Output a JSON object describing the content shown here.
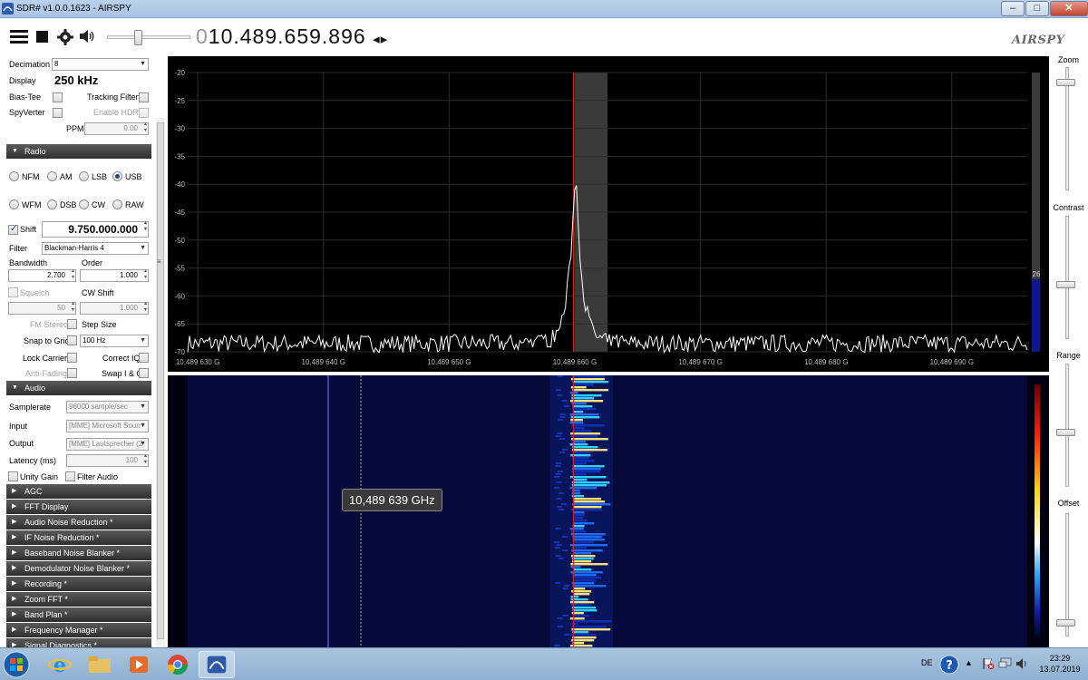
{
  "window": {
    "title": "SDR# v1.0.0.1623 - AIRSPY",
    "controls": {
      "minimize": "–",
      "maximize": "□",
      "close": "✕"
    }
  },
  "toolbar": {
    "frequency_lead": "0",
    "frequency": "10.489.659.896",
    "freq_arrows": "◂▸",
    "logo": "AIRSPY",
    "icons": [
      "menu-icon",
      "stop-icon",
      "gear-icon",
      "speaker-icon"
    ],
    "volume_level": 0.35
  },
  "source": {
    "decimation_label": "Decimation",
    "decimation_value": "8",
    "display_label": "Display",
    "display_value": "250 kHz",
    "bias_tee_label": "Bias-Tee",
    "tracking_filter_label": "Tracking Filter",
    "spyverter_label": "SpyVerter",
    "enable_hdr_label": "Enable HDR",
    "ppm_label": "PPM",
    "ppm_value": "0.00"
  },
  "radio": {
    "section_label": "Radio",
    "modes": [
      {
        "label": "NFM",
        "selected": false
      },
      {
        "label": "AM",
        "selected": false
      },
      {
        "label": "LSB",
        "selected": false
      },
      {
        "label": "USB",
        "selected": true
      },
      {
        "label": "WFM",
        "selected": false
      },
      {
        "label": "DSB",
        "selected": false
      },
      {
        "label": "CW",
        "selected": false
      },
      {
        "label": "RAW",
        "selected": false
      }
    ],
    "shift_label": "Shift",
    "shift_value": "9.750.000.000",
    "filter_label": "Filter",
    "filter_value": "Blackman-Harris 4",
    "bandwidth_label": "Bandwidth",
    "bandwidth_value": "2.700",
    "order_label": "Order",
    "order_value": "1.000",
    "squelch_label": "Squelch",
    "squelch_value": "50",
    "cw_shift_label": "CW Shift",
    "cw_shift_value": "1.000",
    "fm_stereo_label": "FM Stereo",
    "step_size_label": "Step Size",
    "snap_to_grid_label": "Snap to Grid",
    "snap_value": "100 Hz",
    "lock_carrier_label": "Lock Carrier",
    "correct_iq_label": "Correct IQ",
    "anti_fading_label": "Anti-Fading",
    "swap_iq_label": "Swap I & Q"
  },
  "audio": {
    "section_label": "Audio",
    "samplerate_label": "Samplerate",
    "samplerate_value": "96000 sample/sec",
    "input_label": "Input",
    "input_value": "[MME] Microsoft Soun",
    "output_label": "Output",
    "output_value": "[MME] Lautsprecher (2",
    "latency_label": "Latency (ms)",
    "latency_value": "100",
    "unity_gain_label": "Unity Gain",
    "filter_audio_label": "Filter Audio"
  },
  "plugin_sections": [
    "AGC",
    "FFT Display",
    "Audio Noise Reduction *",
    "IF Noise Reduction *",
    "Baseband Noise Blanker *",
    "Demodulator Noise Blanker *",
    "Recording *",
    "Zoom FFT *",
    "Band Plan *",
    "Frequency Manager *",
    "Signal Diagnostics *"
  ],
  "spectrum": {
    "y_ticks": [
      "-20",
      "-25",
      "-30",
      "-35",
      "-40",
      "-45",
      "-50",
      "-55",
      "-60",
      "-65",
      "-70"
    ],
    "x_ticks": [
      "10,489 630 G",
      "10,489 640 G",
      "10,489 650 G",
      "10,489 660 G",
      "10,489 670 G",
      "10,489 680 G",
      "10,489 690 G"
    ],
    "ylim": [
      -70,
      -20
    ],
    "xlim_khz": [
      629.2,
      696.0
    ],
    "tuned_khz": 659.9,
    "filter_band_khz": [
      659.9,
      662.6
    ],
    "peak_db": -36,
    "noise_floor_db": -68.5,
    "level_value": "26",
    "trace_color": "#ffffff",
    "marker_color": "#e02020"
  },
  "waterfall": {
    "tooltip": "10,489 639 GHz",
    "cursor_color": "#5a8cff"
  },
  "right_panel": {
    "zoom_label": "Zoom",
    "contrast_label": "Contrast",
    "range_label": "Range",
    "offset_label": "Offset",
    "zoom_level": 0.1,
    "contrast_level": 0.45,
    "range_level": 0.45,
    "offset_level": 0.1
  },
  "taskbar": {
    "apps": [
      "windows-start-icon",
      "internet-explorer-icon",
      "file-explorer-icon",
      "media-player-icon",
      "chrome-icon",
      "sdr-sharp-icon"
    ],
    "language": "DE",
    "time": "23:29",
    "date": "13.07.2019"
  }
}
